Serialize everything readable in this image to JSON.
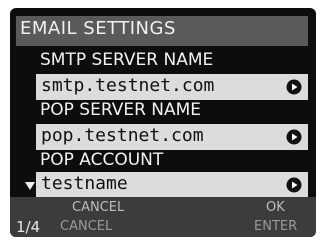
{
  "header": {
    "title": "EMAIL SETTINGS"
  },
  "fields": [
    {
      "label": "SMTP SERVER NAME",
      "value": "smtp.testnet.com",
      "icon": "right-arrow-icon"
    },
    {
      "label": "POP SERVER NAME",
      "value": "pop.testnet.com",
      "icon": "right-arrow-icon"
    },
    {
      "label": "POP ACCOUNT",
      "value": "testname",
      "icon": "right-arrow-icon"
    }
  ],
  "footer": {
    "page": "1/4",
    "cancel_top": "CANCEL",
    "cancel_bottom": "CANCEL",
    "ok": "OK",
    "enter": "ENTER"
  },
  "colors": {
    "screen_bg": "#0d0d0d",
    "header_bg": "#5a5a5a",
    "field_bg": "#dcdcdc",
    "footer_bg": "#3c3c3c"
  }
}
